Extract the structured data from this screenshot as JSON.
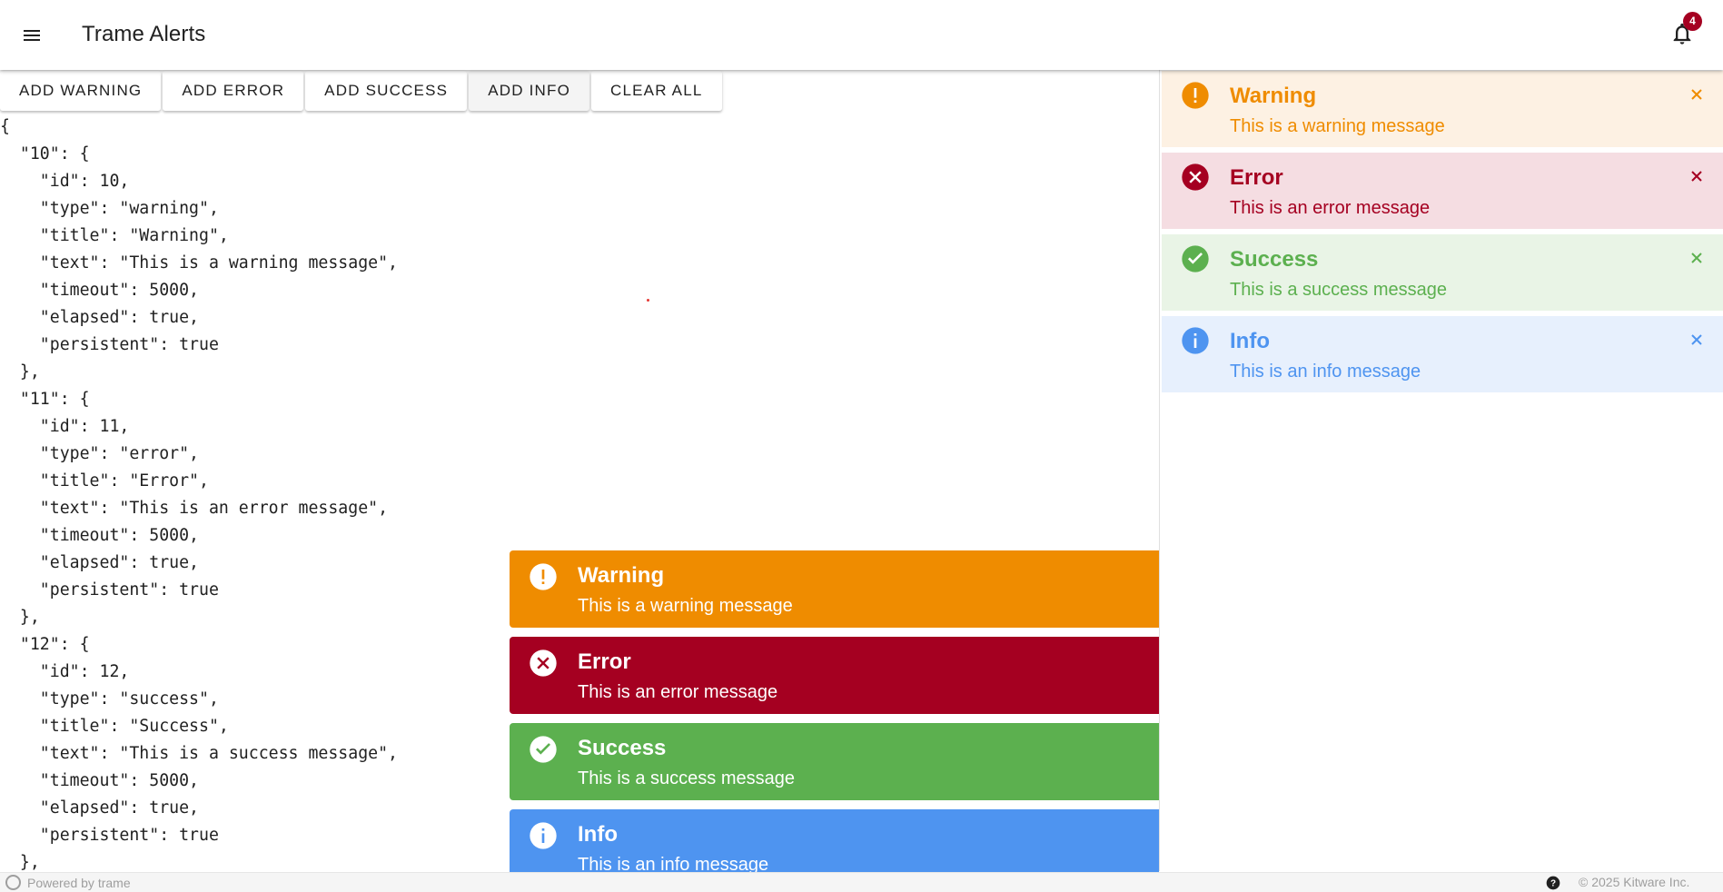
{
  "app": {
    "title": "Trame Alerts",
    "notification_count": "4"
  },
  "toolbar": {
    "add_warning": "ADD WARNING",
    "add_error": "ADD ERROR",
    "add_success": "ADD SUCCESS",
    "add_info": "ADD INFO",
    "clear_all": "CLEAR ALL"
  },
  "state_json": "{\n  \"10\": {\n    \"id\": 10,\n    \"type\": \"warning\",\n    \"title\": \"Warning\",\n    \"text\": \"This is a warning message\",\n    \"timeout\": 5000,\n    \"elapsed\": true,\n    \"persistent\": true\n  },\n  \"11\": {\n    \"id\": 11,\n    \"type\": \"error\",\n    \"title\": \"Error\",\n    \"text\": \"This is an error message\",\n    \"timeout\": 5000,\n    \"elapsed\": true,\n    \"persistent\": true\n  },\n  \"12\": {\n    \"id\": 12,\n    \"type\": \"success\",\n    \"title\": \"Success\",\n    \"text\": \"This is a success message\",\n    \"timeout\": 5000,\n    \"elapsed\": true,\n    \"persistent\": true\n  },",
  "toasts": [
    {
      "type": "warning",
      "icon": "exclamation-circle-icon",
      "title": "Warning",
      "text": "This is a warning message",
      "color": "#ef8c00"
    },
    {
      "type": "error",
      "icon": "close-circle-icon",
      "title": "Error",
      "text": "This is an error message",
      "color": "#a50021"
    },
    {
      "type": "success",
      "icon": "check-circle-icon",
      "title": "Success",
      "text": "This is a success message",
      "color": "#5cb04f"
    },
    {
      "type": "info",
      "icon": "info-circle-icon",
      "title": "Info",
      "text": "This is an info message",
      "color": "#4e94f0"
    }
  ],
  "panel_alerts": [
    {
      "type": "warning",
      "title": "Warning",
      "text": "This is a warning message",
      "color": "#ef8c00",
      "bg": "#fdf1e3"
    },
    {
      "type": "error",
      "title": "Error",
      "text": "This is an error message",
      "color": "#a50021",
      "bg": "#f5dde2"
    },
    {
      "type": "success",
      "title": "Success",
      "text": "This is a success message",
      "color": "#5cb04f",
      "bg": "#e9f4e6"
    },
    {
      "type": "info",
      "title": "Info",
      "text": "This is an info message",
      "color": "#4e94f0",
      "bg": "#e7f0fd"
    }
  ],
  "footer": {
    "powered_by": "Powered by trame",
    "copyright": "© 2025 Kitware Inc."
  }
}
